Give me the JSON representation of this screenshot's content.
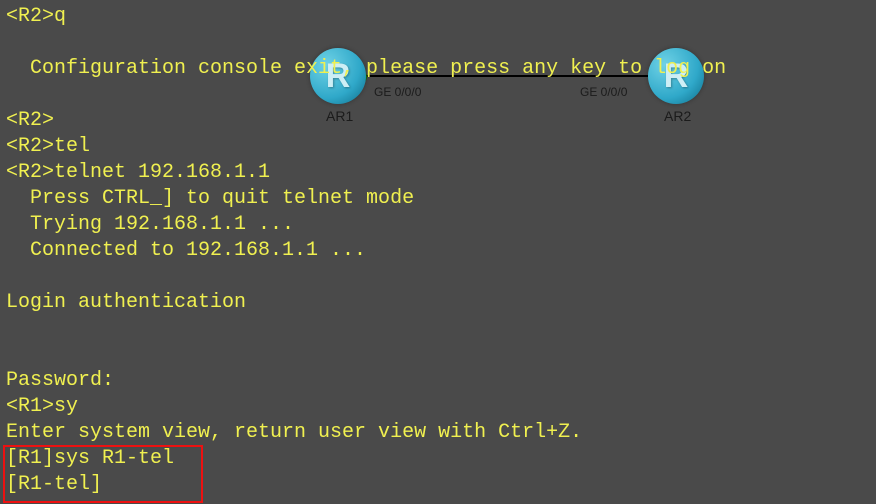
{
  "topology": {
    "router1": {
      "label": "AR1",
      "port": "GE 0/0/0",
      "glyph": "R"
    },
    "router2": {
      "label": "AR2",
      "port": "GE 0/0/0",
      "glyph": "R"
    }
  },
  "terminal": {
    "lines": [
      "<R2>q",
      "",
      "  Configuration console exit, please press any key to log on",
      "",
      "<R2>",
      "<R2>tel",
      "<R2>telnet 192.168.1.1",
      "  Press CTRL_] to quit telnet mode",
      "  Trying 192.168.1.1 ...",
      "  Connected to 192.168.1.1 ...",
      "",
      "Login authentication",
      "",
      "",
      "Password:",
      "<R1>sy",
      "Enter system view, return user view with Ctrl+Z.",
      "[R1]sys R1-tel",
      "[R1-tel]"
    ]
  },
  "highlight": {
    "top_line_index": 17,
    "bottom_line_index": 18
  }
}
